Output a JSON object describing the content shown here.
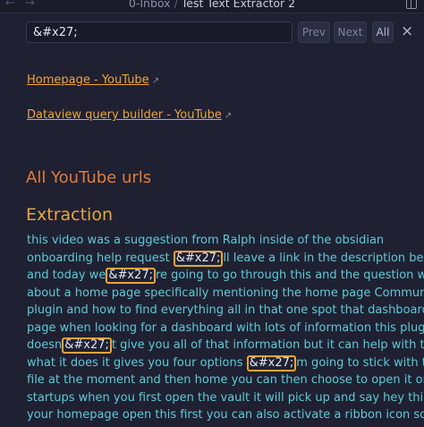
{
  "header": {
    "back_arrow": "←",
    "forward_arrow": "→",
    "folder": "0-Inbox",
    "separator": " / ",
    "file": "Test Text Extractor 2",
    "panel_icon": "panel-toggle-icon"
  },
  "search": {
    "value": "&#x27;",
    "prev_label": "Prev",
    "next_label": "Next",
    "all_label": "All",
    "close_label": "×"
  },
  "links": [
    {
      "label": "Homepage - YouTube",
      "icon": "↗"
    },
    {
      "label": "Dataview query builder - YouTube",
      "icon": "↗"
    }
  ],
  "headings": {
    "urls": "All YouTube urls",
    "extraction": "Extraction"
  },
  "colors": {
    "background": "#1f2132",
    "link": "#f0a33b",
    "heading_urls": "#e37b3a",
    "heading_extraction": "#e8a63a",
    "body_text": "#5ec9d6",
    "match_border": "#f0a33b"
  },
  "body_lines": [
    {
      "pre": "this video was a suggestion from Ralph inside of the obsidian",
      "match": "",
      "post": ""
    },
    {
      "pre": "onboarding help request ",
      "match": "&#x27;",
      "post": "ll leave a link in the description below"
    },
    {
      "pre": "and today we",
      "match": "&#x27;",
      "post": "re going to go through this and the question was"
    },
    {
      "pre": "about a home page specifically mentioning the home page Community",
      "match": "",
      "post": ""
    },
    {
      "pre": "plugin and how to find everything all in that one spot that dashboard",
      "match": "",
      "post": ""
    },
    {
      "pre": "page when looking for a dashboard with lots of information this plugin",
      "match": "",
      "post": ""
    },
    {
      "pre": "doesn",
      "match": "&#x27;",
      "post": "t give you all of that information but it can help with that so"
    },
    {
      "pre": "what it does it gives you four options ",
      "match": "&#x27;",
      "post": "m going to stick with the"
    },
    {
      "pre": "file at the moment and then home you can then choose to open it on",
      "match": "",
      "post": ""
    },
    {
      "pre": "startups when you first open the vault it will pick up and say hey this is",
      "match": "",
      "post": ""
    },
    {
      "pre": "your homepage open this first you can also activate a ribbon icon so you",
      "match": "",
      "post": ""
    }
  ]
}
